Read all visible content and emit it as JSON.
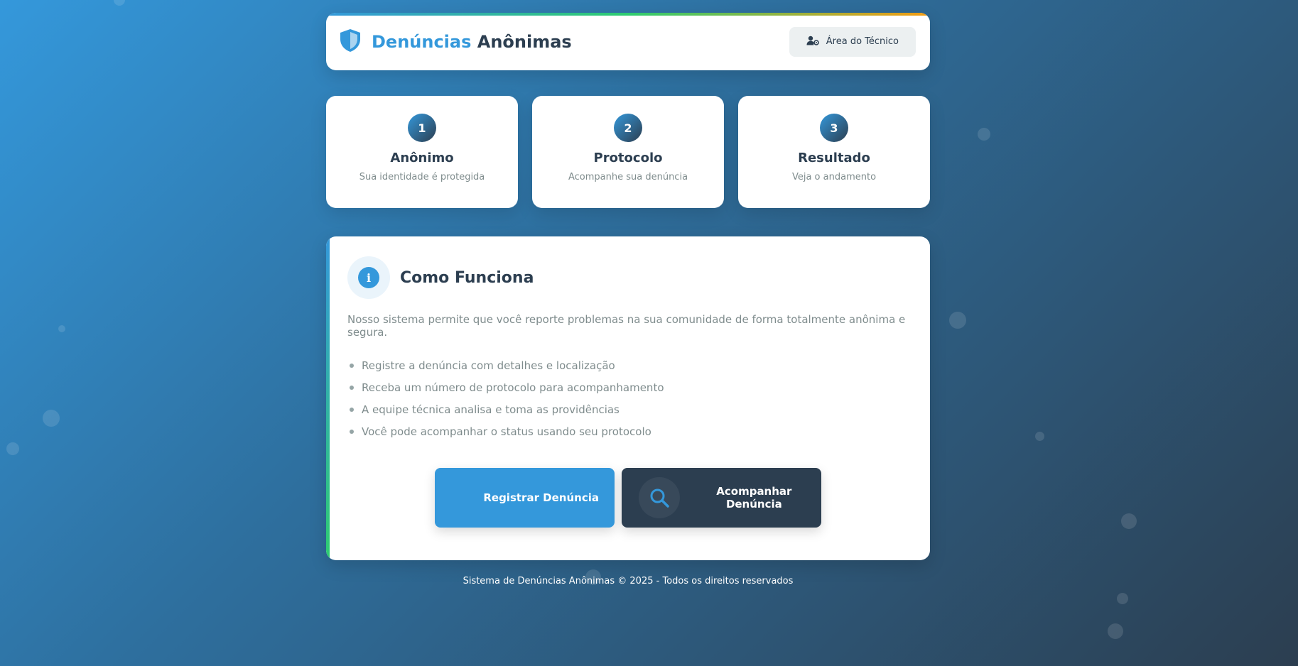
{
  "header": {
    "brand_accent": "Denúncias",
    "brand_rest": " Anônimas",
    "tech_button_label": "Área do Técnico",
    "brand_icon": "shield-icon",
    "tech_icon": "user-gear-icon"
  },
  "steps": [
    {
      "number": "1",
      "title": "Anônimo",
      "description": "Sua identidade é protegida"
    },
    {
      "number": "2",
      "title": "Protocolo",
      "description": "Acompanhe sua denúncia"
    },
    {
      "number": "3",
      "title": "Resultado",
      "description": "Veja o andamento"
    }
  ],
  "info": {
    "icon_glyph": "i",
    "title": "Como Funciona",
    "text": "Nosso sistema permite que você reporte problemas na sua comunidade de forma totalmente anônima e segura.",
    "list": [
      "Registre a denúncia com detalhes e localização",
      "Receba um número de protocolo para acompanhamento",
      "A equipe técnica analisa e toma as providências",
      "Você pode acompanhar o status usando seu protocolo"
    ]
  },
  "actions": {
    "register_label": "Registrar Denúncia",
    "track_label": "Acompanhar Denúncia",
    "track_icon": "search-icon"
  },
  "footer": {
    "text": "Sistema de Denúncias Anônimas © 2025 - Todos os direitos reservados"
  },
  "colors": {
    "accent": "#3498db",
    "dark": "#2c3e50",
    "success": "#2ecc71",
    "warning": "#f39c12"
  }
}
